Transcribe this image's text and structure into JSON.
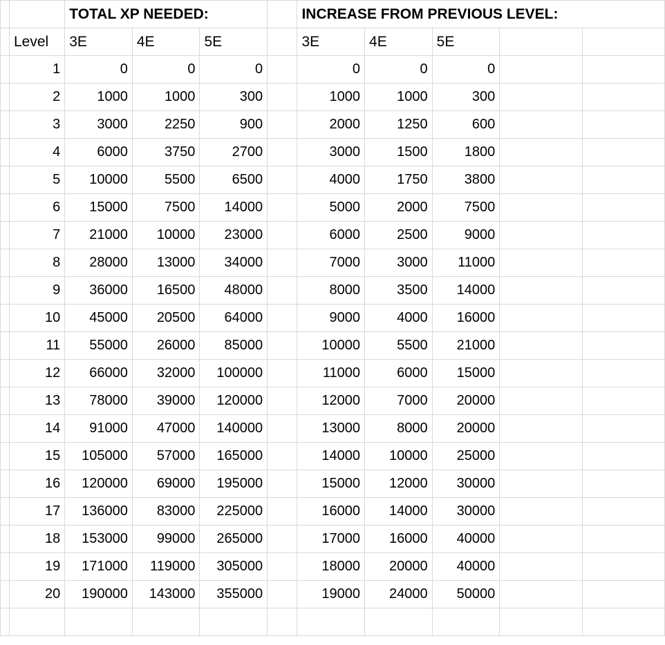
{
  "headers": {
    "section_total": "TOTAL XP NEEDED:",
    "section_increase": "INCREASE FROM PREVIOUS LEVEL:",
    "level": "Level",
    "e3": "3E",
    "e4": "4E",
    "e5": "5E"
  },
  "rows": [
    {
      "level": 1,
      "total": {
        "e3": 0,
        "e4": 0,
        "e5": 0
      },
      "increase": {
        "e3": 0,
        "e4": 0,
        "e5": 0
      }
    },
    {
      "level": 2,
      "total": {
        "e3": 1000,
        "e4": 1000,
        "e5": 300
      },
      "increase": {
        "e3": 1000,
        "e4": 1000,
        "e5": 300
      }
    },
    {
      "level": 3,
      "total": {
        "e3": 3000,
        "e4": 2250,
        "e5": 900
      },
      "increase": {
        "e3": 2000,
        "e4": 1250,
        "e5": 600
      }
    },
    {
      "level": 4,
      "total": {
        "e3": 6000,
        "e4": 3750,
        "e5": 2700
      },
      "increase": {
        "e3": 3000,
        "e4": 1500,
        "e5": 1800
      }
    },
    {
      "level": 5,
      "total": {
        "e3": 10000,
        "e4": 5500,
        "e5": 6500
      },
      "increase": {
        "e3": 4000,
        "e4": 1750,
        "e5": 3800
      }
    },
    {
      "level": 6,
      "total": {
        "e3": 15000,
        "e4": 7500,
        "e5": 14000
      },
      "increase": {
        "e3": 5000,
        "e4": 2000,
        "e5": 7500
      }
    },
    {
      "level": 7,
      "total": {
        "e3": 21000,
        "e4": 10000,
        "e5": 23000
      },
      "increase": {
        "e3": 6000,
        "e4": 2500,
        "e5": 9000
      }
    },
    {
      "level": 8,
      "total": {
        "e3": 28000,
        "e4": 13000,
        "e5": 34000
      },
      "increase": {
        "e3": 7000,
        "e4": 3000,
        "e5": 11000
      }
    },
    {
      "level": 9,
      "total": {
        "e3": 36000,
        "e4": 16500,
        "e5": 48000
      },
      "increase": {
        "e3": 8000,
        "e4": 3500,
        "e5": 14000
      }
    },
    {
      "level": 10,
      "total": {
        "e3": 45000,
        "e4": 20500,
        "e5": 64000
      },
      "increase": {
        "e3": 9000,
        "e4": 4000,
        "e5": 16000
      }
    },
    {
      "level": 11,
      "total": {
        "e3": 55000,
        "e4": 26000,
        "e5": 85000
      },
      "increase": {
        "e3": 10000,
        "e4": 5500,
        "e5": 21000
      }
    },
    {
      "level": 12,
      "total": {
        "e3": 66000,
        "e4": 32000,
        "e5": 100000
      },
      "increase": {
        "e3": 11000,
        "e4": 6000,
        "e5": 15000
      }
    },
    {
      "level": 13,
      "total": {
        "e3": 78000,
        "e4": 39000,
        "e5": 120000
      },
      "increase": {
        "e3": 12000,
        "e4": 7000,
        "e5": 20000
      }
    },
    {
      "level": 14,
      "total": {
        "e3": 91000,
        "e4": 47000,
        "e5": 140000
      },
      "increase": {
        "e3": 13000,
        "e4": 8000,
        "e5": 20000
      }
    },
    {
      "level": 15,
      "total": {
        "e3": 105000,
        "e4": 57000,
        "e5": 165000
      },
      "increase": {
        "e3": 14000,
        "e4": 10000,
        "e5": 25000
      }
    },
    {
      "level": 16,
      "total": {
        "e3": 120000,
        "e4": 69000,
        "e5": 195000
      },
      "increase": {
        "e3": 15000,
        "e4": 12000,
        "e5": 30000
      }
    },
    {
      "level": 17,
      "total": {
        "e3": 136000,
        "e4": 83000,
        "e5": 225000
      },
      "increase": {
        "e3": 16000,
        "e4": 14000,
        "e5": 30000
      }
    },
    {
      "level": 18,
      "total": {
        "e3": 153000,
        "e4": 99000,
        "e5": 265000
      },
      "increase": {
        "e3": 17000,
        "e4": 16000,
        "e5": 40000
      }
    },
    {
      "level": 19,
      "total": {
        "e3": 171000,
        "e4": 119000,
        "e5": 305000
      },
      "increase": {
        "e3": 18000,
        "e4": 20000,
        "e5": 40000
      }
    },
    {
      "level": 20,
      "total": {
        "e3": 190000,
        "e4": 143000,
        "e5": 355000
      },
      "increase": {
        "e3": 19000,
        "e4": 24000,
        "e5": 50000
      }
    }
  ],
  "chart_data": {
    "type": "table",
    "title": "D&D XP needed per level across editions",
    "columns": [
      "Level",
      "Total 3E",
      "Total 4E",
      "Total 5E",
      "Increase 3E",
      "Increase 4E",
      "Increase 5E"
    ],
    "data": [
      [
        1,
        0,
        0,
        0,
        0,
        0,
        0
      ],
      [
        2,
        1000,
        1000,
        300,
        1000,
        1000,
        300
      ],
      [
        3,
        3000,
        2250,
        900,
        2000,
        1250,
        600
      ],
      [
        4,
        6000,
        3750,
        2700,
        3000,
        1500,
        1800
      ],
      [
        5,
        10000,
        5500,
        6500,
        4000,
        1750,
        3800
      ],
      [
        6,
        15000,
        7500,
        14000,
        5000,
        2000,
        7500
      ],
      [
        7,
        21000,
        10000,
        23000,
        6000,
        2500,
        9000
      ],
      [
        8,
        28000,
        13000,
        34000,
        7000,
        3000,
        11000
      ],
      [
        9,
        36000,
        16500,
        48000,
        8000,
        3500,
        14000
      ],
      [
        10,
        45000,
        20500,
        64000,
        9000,
        4000,
        16000
      ],
      [
        11,
        55000,
        26000,
        85000,
        10000,
        5500,
        21000
      ],
      [
        12,
        66000,
        32000,
        100000,
        11000,
        6000,
        15000
      ],
      [
        13,
        78000,
        39000,
        120000,
        12000,
        7000,
        20000
      ],
      [
        14,
        91000,
        47000,
        140000,
        13000,
        8000,
        20000
      ],
      [
        15,
        105000,
        57000,
        165000,
        14000,
        10000,
        25000
      ],
      [
        16,
        120000,
        69000,
        195000,
        15000,
        12000,
        30000
      ],
      [
        17,
        136000,
        83000,
        225000,
        16000,
        14000,
        30000
      ],
      [
        18,
        153000,
        99000,
        265000,
        17000,
        16000,
        40000
      ],
      [
        19,
        171000,
        119000,
        305000,
        18000,
        20000,
        40000
      ],
      [
        20,
        190000,
        143000,
        355000,
        19000,
        24000,
        50000
      ]
    ]
  }
}
